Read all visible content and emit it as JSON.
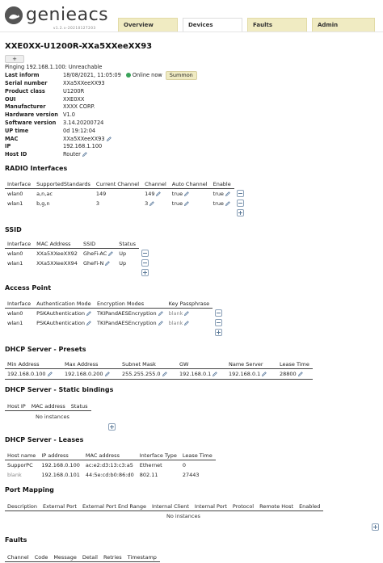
{
  "app": {
    "logo": "genieacs",
    "version": "v1.2.x-20210127203"
  },
  "tabs": [
    "Overview",
    "Devices",
    "Faults",
    "Admin"
  ],
  "device": {
    "title": "XXE0XX-U1200R-XXa5XXeeXX93",
    "tag_add": "+",
    "pinging": "Pinging 192.168.1.100: Unreachable",
    "last_inform_label": "Last inform",
    "last_inform_value": "18/08/2021, 11:05:09",
    "online_text": "Online now",
    "summon_label": "Summon",
    "fields": [
      {
        "label": "Serial number",
        "value": "XXa5XXeeXX93"
      },
      {
        "label": "Product class",
        "value": "U1200R"
      },
      {
        "label": "OUI",
        "value": "XXE0XX"
      },
      {
        "label": "Manufacturer",
        "value": "XXXX CORP."
      },
      {
        "label": "Hardware version",
        "value": "V1.0"
      },
      {
        "label": "Software version",
        "value": "3.14.20200724"
      },
      {
        "label": "UP time",
        "value": "0d 19:12:04"
      },
      {
        "label": "MAC",
        "value": "XXa5XXeeXX93"
      },
      {
        "label": "IP",
        "value": "192.168.1.100"
      },
      {
        "label": "Host ID",
        "value": "Router"
      }
    ]
  },
  "radio": {
    "title": "RADIO Interfaces",
    "headers": [
      "Interface",
      "SupportedStandards",
      "Current Channel",
      "Channel",
      "Auto Channel",
      "Enable"
    ],
    "rows": [
      [
        "wlan0",
        "a,n,ac",
        "149",
        "149",
        "true",
        "true"
      ],
      [
        "wlan1",
        "b,g,n",
        "3",
        "3",
        "true",
        "true"
      ]
    ]
  },
  "ssid": {
    "title": "SSID",
    "headers": [
      "Interface",
      "MAC Address",
      "SSID",
      "Status"
    ],
    "rows": [
      [
        "wlan0",
        "XXa5XXeeXX92",
        "GheFi-AC",
        "Up"
      ],
      [
        "wlan1",
        "XXa5XXeeXX94",
        "GheFi-N",
        "Up"
      ]
    ]
  },
  "ap": {
    "title": "Access Point",
    "headers": [
      "Interface",
      "Authentication Mode",
      "Encryption Modes",
      "Key Passphrase"
    ],
    "rows": [
      [
        "wlan0",
        "PSKAuthentication",
        "TKIPandAESEncryption",
        "blank"
      ],
      [
        "wlan1",
        "PSKAuthentication",
        "TKIPandAESEncryption",
        "blank"
      ]
    ]
  },
  "dhcp_presets": {
    "title": "DHCP Server - Presets",
    "headers": [
      "Min Address",
      "Max Address",
      "Subnet Mask",
      "GW",
      "Name Server",
      "Lease Time"
    ],
    "row": [
      "192.168.0.100",
      "192.168.0.200",
      "255.255.255.0",
      "192.168.0.1",
      "192.168.0.1",
      "28800"
    ]
  },
  "dhcp_static": {
    "title": "DHCP Server - Static bindings",
    "headers": [
      "Host IP",
      "MAC address",
      "Status"
    ],
    "empty": "No instances"
  },
  "dhcp_leases": {
    "title": "DHCP Server - Leases",
    "headers": [
      "Host name",
      "IP address",
      "MAC address",
      "Interface Type",
      "Lease Time"
    ],
    "rows": [
      [
        "SupporPC",
        "192.168.0.100",
        "ac:e2:d3:13:c3:a5",
        "Ethernet",
        "0"
      ],
      [
        "blank",
        "192.168.0.101",
        "44:5e:cd:b0:86:d0",
        "802.11",
        "27443"
      ]
    ]
  },
  "port_mapping": {
    "title": "Port Mapping",
    "headers": [
      "Description",
      "External Port",
      "External Port End Range",
      "Internal Client",
      "Internal Port",
      "Protocol",
      "Remote Host",
      "Enabled"
    ],
    "empty": "No instances"
  },
  "faults": {
    "title": "Faults",
    "headers": [
      "Channel",
      "Code",
      "Message",
      "Detail",
      "Retries",
      "Timestamp"
    ]
  }
}
